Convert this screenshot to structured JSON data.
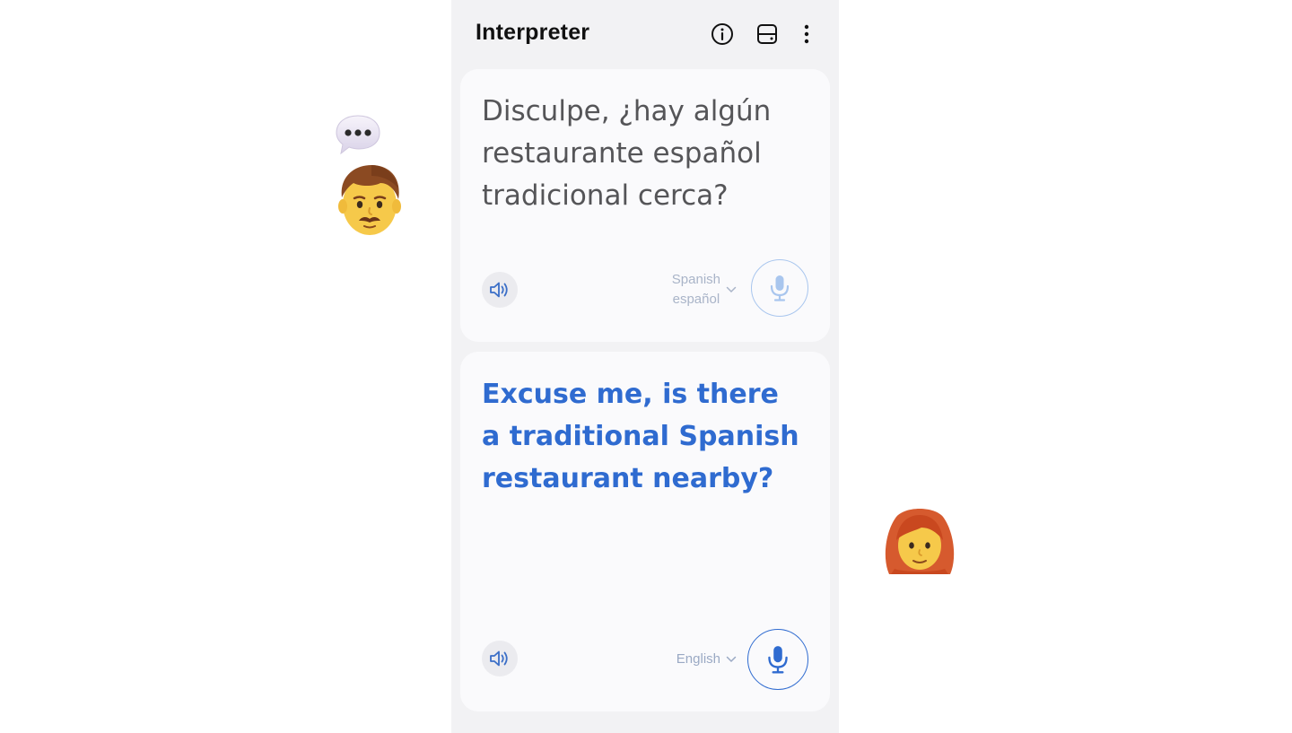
{
  "app": {
    "title": "Interpreter"
  },
  "appbar": {
    "info_icon": "info-icon",
    "layout_icon": "split-layout-icon",
    "more_icon": "more-vert-icon"
  },
  "top_panel": {
    "text": "Disculpe, ¿hay algún restaurante español tradicional cerca?",
    "language_name": "Spanish",
    "language_native": "español",
    "speaker_icon": "speaker-icon",
    "mic_icon": "mic-icon"
  },
  "bottom_panel": {
    "text": "Excuse me, is there a traditional Spanish restaurant nearby?",
    "language_name": "English",
    "speaker_icon": "speaker-icon",
    "mic_icon": "mic-icon"
  },
  "decor": {
    "left_person": "man-emoji",
    "speech_bubble": "speech-bubble-emoji",
    "right_person": "woman-red-hair-emoji"
  },
  "colors": {
    "accent": "#2f6bd0",
    "mic_inactive_border": "#a9c6ee",
    "panel_bg": "#fafafc",
    "phone_bg": "#f2f2f4"
  }
}
